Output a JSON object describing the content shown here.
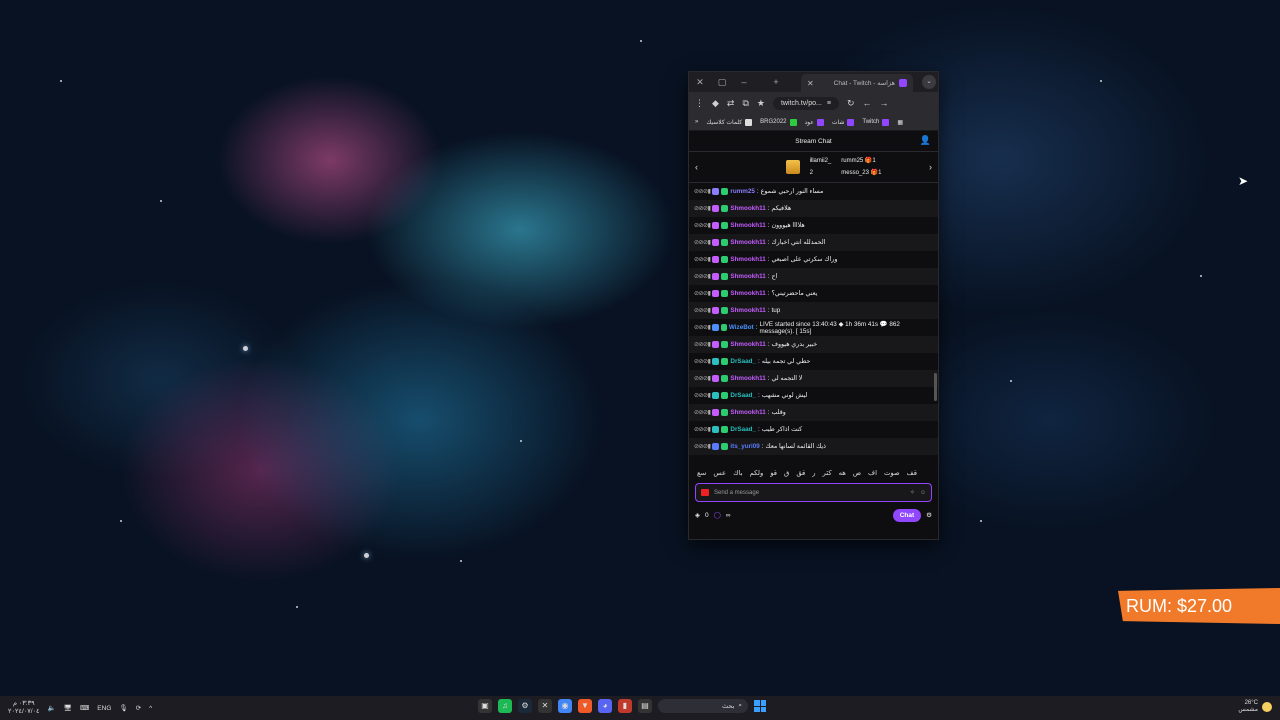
{
  "browser": {
    "tab_title": "Chat - Twitch - هزاسه",
    "url": "twitch.tv/po...",
    "bookmarks": [
      "Twitch",
      "شات",
      "عود",
      "BRG2022",
      "كلمات كلاسيك"
    ]
  },
  "chat": {
    "header": "Stream Chat",
    "gifts": {
      "left_user": "illamii2_",
      "left_count": "2",
      "right_top_user": "rumm25",
      "right_top_count": "1",
      "right_bottom_user": "messo_23",
      "right_bottom_count": "1"
    },
    "messages": [
      {
        "user": "rumm25",
        "color": "#8a7dff",
        "text": "مساء النور ارحبي شموع"
      },
      {
        "user": "Shmookh11",
        "color": "#c45cff",
        "text": "هلافيكم"
      },
      {
        "user": "Shmookh11",
        "color": "#c45cff",
        "text": "هلاااا هيووون"
      },
      {
        "user": "Shmookh11",
        "color": "#c45cff",
        "text": "الحمدلله انتي اخبارك"
      },
      {
        "user": "Shmookh11",
        "color": "#c45cff",
        "text": "وراك سكرتي على اصبعي"
      },
      {
        "user": "Shmookh11",
        "color": "#c45cff",
        "text": "اح"
      },
      {
        "user": "Shmookh11",
        "color": "#c45cff",
        "text": "يعني ماحضرتيني؟"
      },
      {
        "user": "Shmookh11",
        "color": "#c45cff",
        "text": "tup"
      },
      {
        "user": "WizeBot",
        "color": "#4a90ff",
        "text": "LIVE started since 13:40:43 ◆ 1h 36m 41s 💬 862 message(s). [ 15s]"
      },
      {
        "user": "Shmookh11",
        "color": "#c45cff",
        "text": "خبير بدري هيووف"
      },
      {
        "user": "DrSaad_",
        "color": "#2bbfbf",
        "text": "حطي لي تجمة بيله"
      },
      {
        "user": "Shmookh11",
        "color": "#c45cff",
        "text": "لا التجمه لي"
      },
      {
        "user": "DrSaad_",
        "color": "#2bbfbf",
        "text": "ليش لوني مشهب"
      },
      {
        "user": "Shmookh11",
        "color": "#c45cff",
        "text": "وقلب"
      },
      {
        "user": "DrSaad_",
        "color": "#2bbfbf",
        "text": "كنت اذاكر طيب"
      },
      {
        "user": "its_yuri09",
        "color": "#5a7bff",
        "text": "ذيك القائمة لسانها معك"
      }
    ],
    "quick_words": [
      "قف",
      "صوت",
      "اف",
      "ص",
      "هه",
      "كثر",
      "ر",
      "قق",
      "ق",
      "قو",
      "ولكم",
      "باك",
      "عس",
      "سع"
    ],
    "input_placeholder": "Send a message",
    "points": "0",
    "infinity": "∞",
    "send_label": "Chat"
  },
  "overlay": {
    "rum_text": "RUM: $27.00"
  },
  "taskbar": {
    "time": "٠٣:٣٩ م",
    "date": "٢٠٢٤/٠٧/٠٤",
    "lang": "ENG",
    "search_placeholder": "بحث",
    "temp": "26°C",
    "weather_desc": "مشمس"
  }
}
